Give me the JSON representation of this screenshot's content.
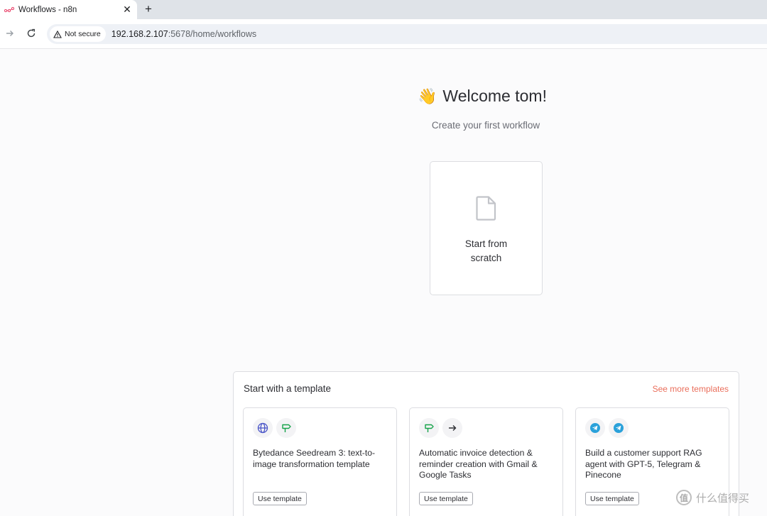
{
  "browser": {
    "tab_title": "Workflows - n8n",
    "tab_close": "✕",
    "new_tab": "+",
    "security_label": "Not secure",
    "url_host": "192.168.2.107",
    "url_rest": ":5678/home/workflows"
  },
  "welcome": {
    "emoji": "👋",
    "title": "Welcome tom!",
    "subtitle": "Create your first workflow"
  },
  "scratch": {
    "label": "Start from scratch"
  },
  "templates": {
    "title": "Start with a template",
    "see_more": "See more templates",
    "items": [
      {
        "name": "Bytedance Seedream 3: text-to-image transformation template",
        "button": "Use template",
        "icons": [
          "globe-icon",
          "signpost-icon"
        ]
      },
      {
        "name": "Automatic invoice detection & reminder creation with Gmail & Google Tasks",
        "button": "Use template",
        "icons": [
          "signpost-icon",
          "arrow-right-icon"
        ]
      },
      {
        "name": "Build a customer support RAG agent with GPT-5, Telegram & Pinecone",
        "button": "Use template",
        "icons": [
          "telegram-icon",
          "telegram-icon"
        ]
      }
    ]
  },
  "watermark": {
    "badge": "值",
    "text": "什么值得买"
  },
  "colors": {
    "accent": "#ea6e5b",
    "globe": "#4a55c8",
    "signpost": "#16a34a",
    "telegram": "#2aa1da"
  }
}
